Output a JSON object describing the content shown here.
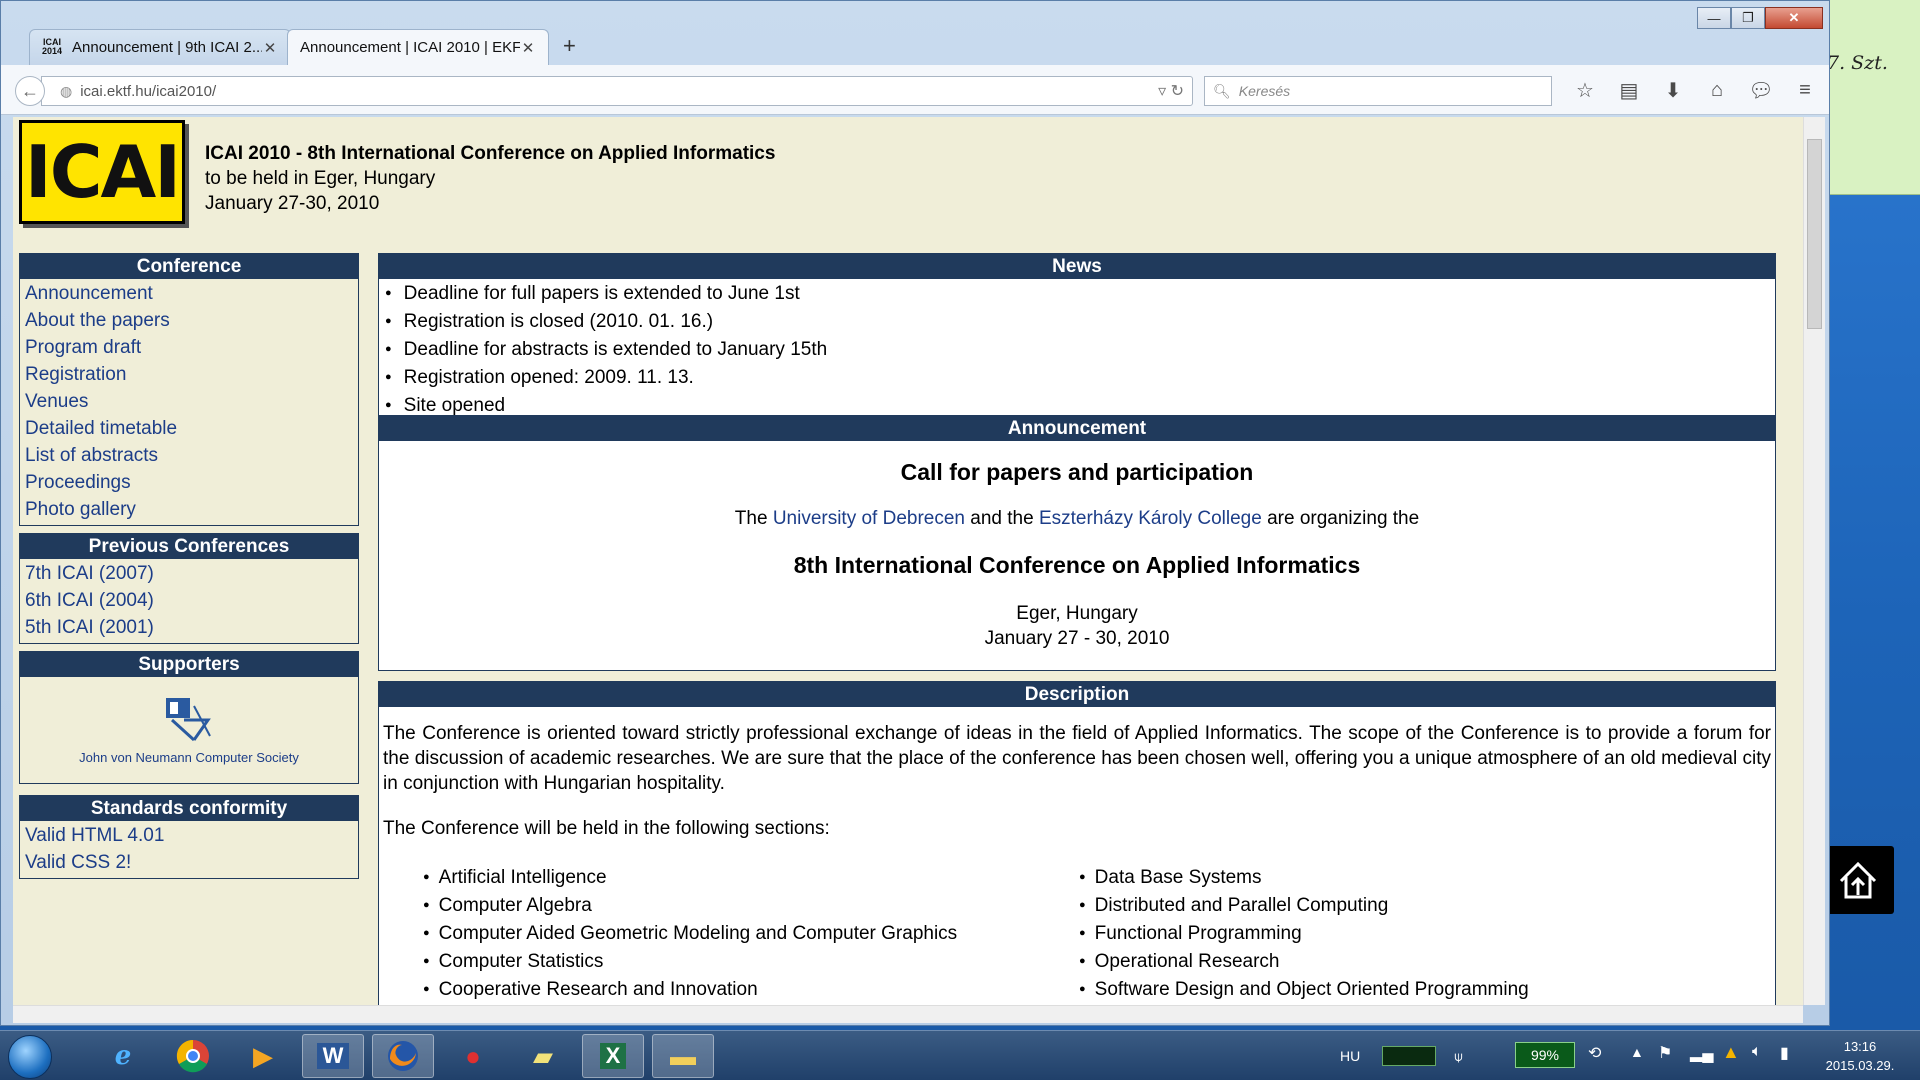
{
  "desktop": {
    "sticky_note_text": "7. Szt."
  },
  "browser": {
    "tabs": [
      {
        "label": "Announcement | 9th ICAI 2...",
        "icon_text_top": "ICAI",
        "icon_text_bottom": "2014"
      },
      {
        "label": "Announcement | ICAI 2010 | EKF"
      }
    ],
    "url": "icai.ektf.hu/icai2010/",
    "search_placeholder": "Keresés",
    "window_buttons": [
      "—",
      "❐",
      "✕"
    ],
    "toolbar_icons": [
      "star-icon",
      "reading-list-icon",
      "download-icon",
      "home-icon",
      "chat-icon",
      "menu-icon"
    ]
  },
  "page": {
    "logo_text": "ICAI",
    "header": {
      "title": "ICAI 2010 - 8th International Conference on Applied Informatics",
      "line2": "to be held in Eger, Hungary",
      "line3": "January 27-30, 2010"
    },
    "sidebar": {
      "conference": {
        "title": "Conference",
        "items": [
          "Announcement",
          "About the papers",
          "Program draft",
          "Registration",
          "Venues",
          "Detailed timetable",
          "List of abstracts",
          "Proceedings",
          "Photo gallery"
        ]
      },
      "previous": {
        "title": "Previous Conferences",
        "items": [
          "7th ICAI (2007)",
          "6th ICAI (2004)",
          "5th ICAI (2001)"
        ]
      },
      "supporters": {
        "title": "Supporters",
        "name": "John von Neumann Computer Society"
      },
      "standards": {
        "title": "Standards conformity",
        "items": [
          "Valid HTML 4.01",
          "Valid CSS 2!"
        ]
      }
    },
    "news": {
      "title": "News",
      "items": [
        "Deadline for full papers is extended to June 1st",
        "Registration is closed (2010. 01. 16.)",
        "Deadline for abstracts is extended to January 15th",
        "Registration opened: 2009. 11. 13.",
        "Site opened"
      ]
    },
    "announcement": {
      "title": "Announcement",
      "heading": "Call for papers and participation",
      "line_the": "The",
      "link1": "University of Debrecen",
      "and_the": "and the",
      "link2": "Eszterházy Károly College",
      "organizing": "are organizing the",
      "conference": "8th International Conference on Applied Informatics",
      "place": "Eger, Hungary",
      "dates": "January 27 - 30, 2010"
    },
    "description": {
      "title": "Description",
      "para1": "The Conference is oriented toward strictly professional exchange of ideas in the field of Applied Informatics. The scope of the Conference is to provide a forum for the discussion of academic researches. We are sure that the place of the conference has been chosen well, offering you a unique atmosphere of an old medieval city in conjunction with Hungarian hospitality.",
      "para2": "The Conference will be held in the following sections:",
      "sections_left": [
        "Artificial Intelligence",
        "Computer Algebra",
        "Computer Aided Geometric Modeling and Computer Graphics",
        "Computer Statistics",
        "Cooperative Research and Innovation"
      ],
      "sections_right": [
        "Data Base Systems",
        "Distributed and Parallel Computing",
        "Functional Programming",
        "Operational Research",
        "Software Design and Object Oriented Programming"
      ]
    }
  },
  "taskbar": {
    "apps": [
      "internet-explorer-icon",
      "chrome-icon",
      "media-player-icon",
      "word-icon",
      "firefox-icon",
      "app-icon",
      "sticky-notes-icon",
      "excel-icon",
      "explorer-icon"
    ],
    "language": "HU",
    "battery": "99%",
    "time": "13:16",
    "date": "2015.03.29."
  },
  "colors": {
    "nav_header": "#203a5c",
    "link": "#1c3d88",
    "page_background": "#f0eed8",
    "logo_yellow": "#ffe400"
  }
}
